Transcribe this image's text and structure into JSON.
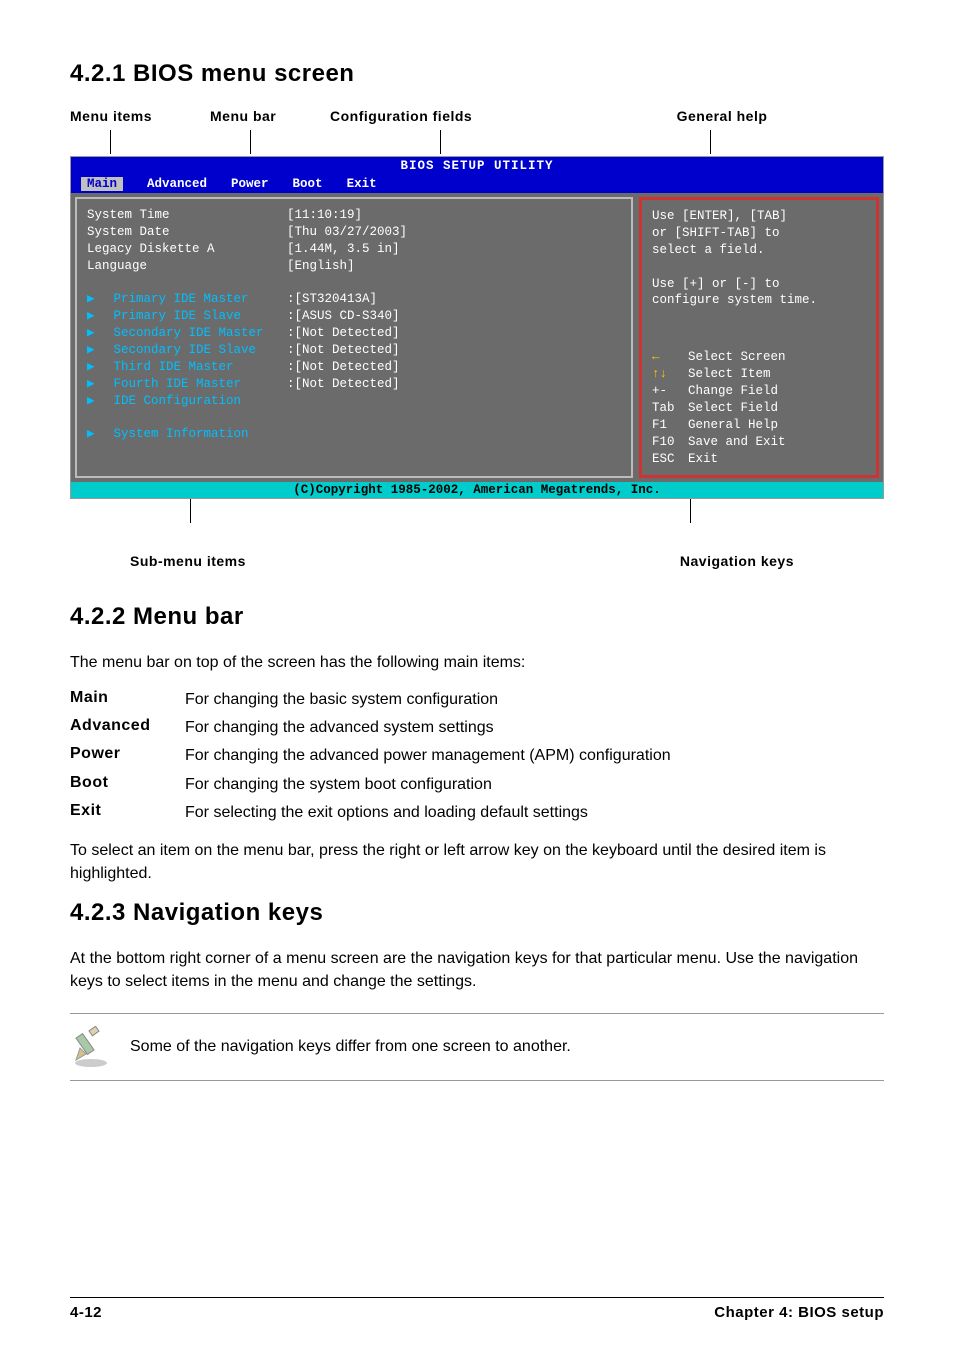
{
  "section1": {
    "heading": "4.2.1   BIOS menu screen",
    "labels": {
      "menuitems": "Menu items",
      "menubar": "Menu bar",
      "config": "Configuration fields",
      "general": "General help",
      "submenu": "Sub-menu items",
      "navkeys": "Navigation keys"
    }
  },
  "bios": {
    "title": "BIOS SETUP UTILITY",
    "tabs": [
      "Main",
      "Advanced",
      "Power",
      "Boot",
      "Exit"
    ],
    "left_labels": [
      "System Time",
      "System Date",
      "Legacy Diskette A",
      "Language",
      "",
      "  Primary IDE Master",
      "  Primary IDE Slave",
      "  Secondary IDE Master",
      "  Secondary IDE Slave",
      "  Third IDE Master",
      "  Fourth IDE Master",
      "  IDE Configuration",
      "",
      "  System Information"
    ],
    "left_values": [
      "[11:10:19]",
      "[Thu 03/27/2003]",
      "[1.44M, 3.5 in]",
      "[English]",
      "",
      ":[ST320413A]",
      ":[ASUS CD-S340]",
      ":[Not Detected]",
      ":[Not Detected]",
      ":[Not Detected]",
      ":[Not Detected]",
      "",
      "",
      ""
    ],
    "help_top": [
      "Use [ENTER], [TAB]",
      "or [SHIFT-TAB] to",
      "select a field.",
      "",
      "Use [+] or [-] to",
      "configure system time."
    ],
    "nav": [
      {
        "key": "←",
        "label": "Select Screen",
        "arrow": true
      },
      {
        "key": "↑↓",
        "label": "Select Item",
        "arrow": true
      },
      {
        "key": "+-",
        "label": "Change Field"
      },
      {
        "key": "Tab",
        "label": "Select Field"
      },
      {
        "key": "F1",
        "label": "General Help"
      },
      {
        "key": "F10",
        "label": "Save and Exit"
      },
      {
        "key": "ESC",
        "label": "Exit"
      }
    ],
    "footer": "(C)Copyright 1985-2002, American Megatrends, Inc."
  },
  "section2": {
    "heading": "4.2.2   Menu bar",
    "intro": "The menu bar on top of the screen has the following main items:",
    "items": [
      {
        "term": "Main",
        "desc": "For changing the basic system configuration"
      },
      {
        "term": "Advanced",
        "desc": "For changing the advanced system settings"
      },
      {
        "term": "Power",
        "desc": "For changing the advanced power management (APM) configuration"
      },
      {
        "term": "Boot",
        "desc": "For changing the system boot configuration"
      },
      {
        "term": "Exit",
        "desc": "For selecting the exit options and loading default settings"
      }
    ],
    "outro": "To select an item on the menu bar, press the right or left arrow key on the keyboard until the desired item is highlighted."
  },
  "section3": {
    "heading": "4.2.3   Navigation keys",
    "body": "At the bottom right corner of a menu screen are the navigation keys for that particular menu. Use the navigation keys to select items in the menu and change the settings.",
    "note": "Some of the navigation keys differ from one screen to another."
  },
  "footer": {
    "left": "4-12",
    "right": "Chapter 4: BIOS setup"
  }
}
